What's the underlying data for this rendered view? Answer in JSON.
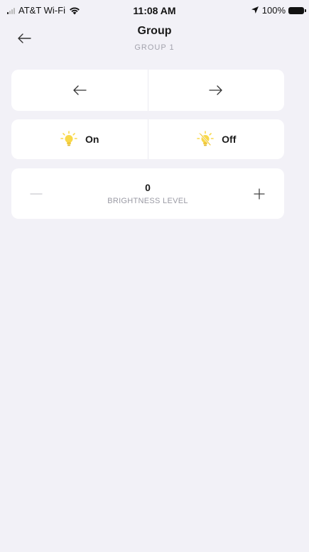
{
  "status_bar": {
    "carrier": "AT&T Wi-Fi",
    "time": "11:08 AM",
    "battery": "100%",
    "icons": [
      "signal-icon",
      "wifi-icon",
      "location-icon",
      "battery-icon"
    ]
  },
  "header": {
    "title": "Group",
    "subtitle": "GROUP 1",
    "back_icon": "back-arrow-icon"
  },
  "navigation_card": {
    "previous_icon": "arrow-left-icon",
    "next_icon": "arrow-right-icon"
  },
  "power_card": {
    "on_label": "On",
    "off_label": "Off",
    "on_icon": "bulb-on-icon",
    "off_icon": "bulb-off-icon"
  },
  "brightness": {
    "value": "0",
    "label": "BRIGHTNESS LEVEL",
    "decrease_icon": "minus-icon",
    "increase_icon": "plus-icon"
  },
  "colors": {
    "background": "#f2f1f7",
    "card": "#ffffff",
    "bulb": "#f8d84a",
    "muted_text": "#a3a3ad"
  }
}
